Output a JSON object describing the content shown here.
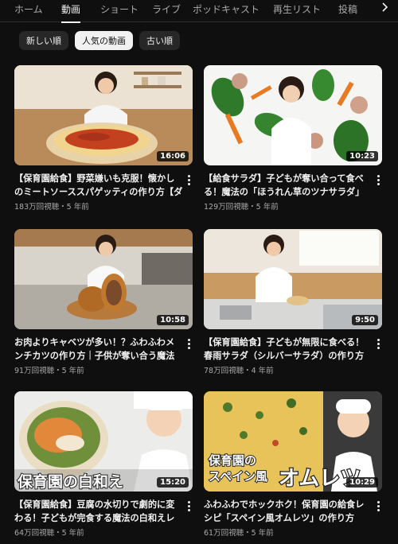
{
  "tabs": [
    {
      "label": "ホーム",
      "active": false
    },
    {
      "label": "動画",
      "active": true
    },
    {
      "label": "ショート",
      "active": false
    },
    {
      "label": "ライブ",
      "active": false
    },
    {
      "label": "ポッドキャスト",
      "active": false
    },
    {
      "label": "再生リスト",
      "active": false
    },
    {
      "label": "投稿",
      "active": false
    }
  ],
  "chips": [
    "新しい順",
    "人気の動画",
    "古い順"
  ],
  "selected_chip": "人気の動画",
  "videos": [
    {
      "title": "【保育園給食】野菜嫌いも克服！懐かしのミートソーススパゲッティの作り方【ダイソ…",
      "meta": "183万回視聴・5 年前",
      "duration": "16:06"
    },
    {
      "title": "【給食サラダ】子どもが奪い合って食べる！魔法の「ほうれん草のツナサラダ」【保育…",
      "meta": "129万回視聴・5 年前",
      "duration": "10:23"
    },
    {
      "title": "お肉よりキャベツが多い！？ふわふわメンチカツの作り方｜子供が奪い合う魔法のレシピ",
      "meta": "91万回視聴・5 年前",
      "duration": "10:58"
    },
    {
      "title": "【保育園給食】子どもが無限に食べる！春雨サラダ（シルバーサラダ）の作り方【管理…",
      "meta": "78万回視聴・4 年前",
      "duration": "9:50"
    },
    {
      "title": "【保育園給食】豆腐の水切りで劇的に変わる！子どもが完食する魔法の白和えレシピ…",
      "meta": "64万回視聴・5 年前",
      "duration": "15:20"
    },
    {
      "title": "ふわふわでホックホク！保育園の給食レシピ「スペイン風オムレツ」の作り方",
      "meta": "61万回視聴・5 年前",
      "duration": "10:29"
    }
  ],
  "thumb_text": {
    "shiraae": "保育園の白和え",
    "omelette_line1": "保育園の",
    "omelette_line2": "スペイン風",
    "omelette_line3": "オムレツ"
  },
  "icons": {
    "next_tabs": "chevron-right-icon",
    "menu": "more-vert-icon"
  },
  "colors": {
    "background": "#0f0f0f",
    "text": "#f1f1f1",
    "secondary": "#aaaaaa",
    "chip": "#272727"
  }
}
